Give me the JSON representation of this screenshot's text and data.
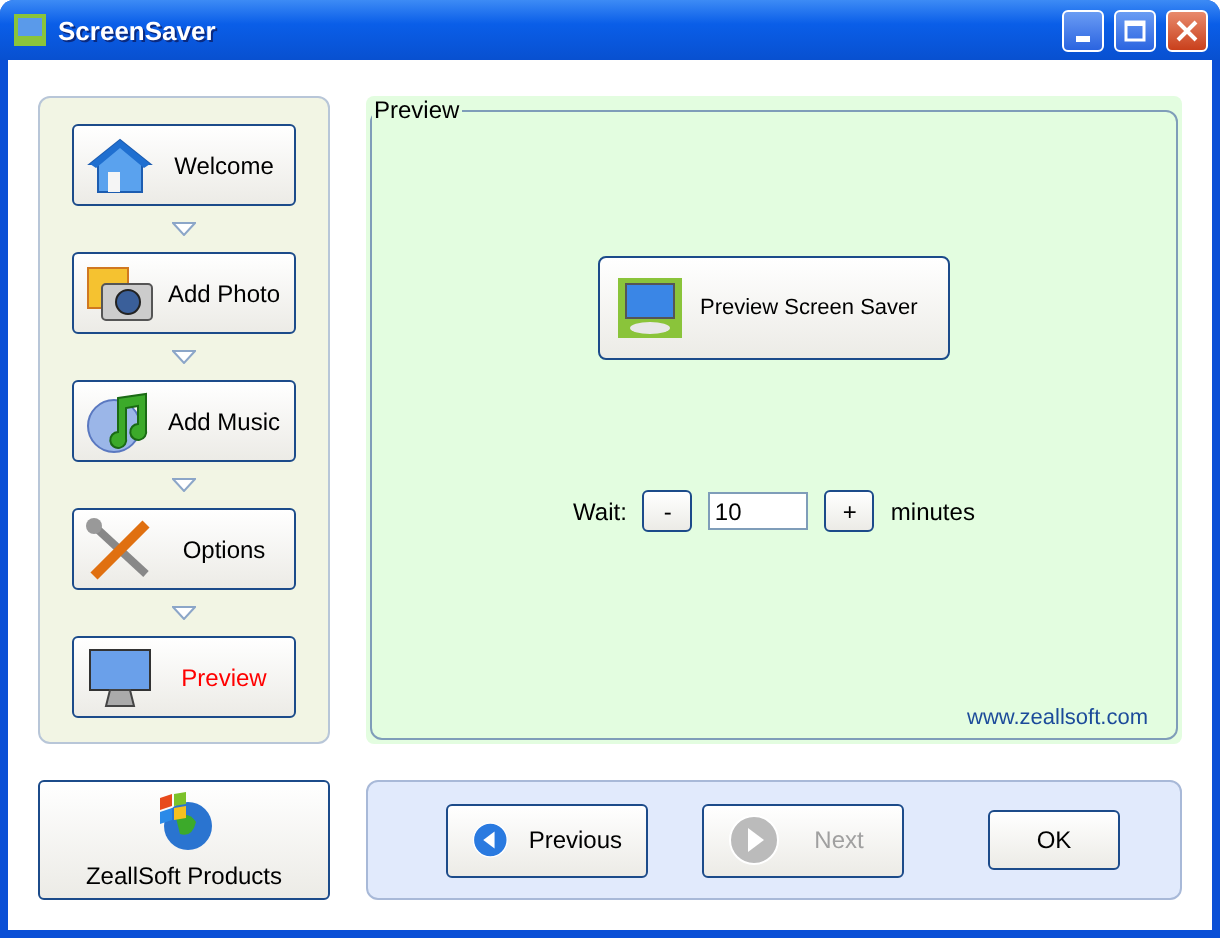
{
  "window": {
    "title": "ScreenSaver"
  },
  "steps": [
    {
      "label": "Welcome",
      "kind": "house",
      "selected": false
    },
    {
      "label": "Add Photo",
      "kind": "camera",
      "selected": false
    },
    {
      "label": "Add Music",
      "kind": "music",
      "selected": false
    },
    {
      "label": "Options",
      "kind": "tools",
      "selected": false
    },
    {
      "label": "Preview",
      "kind": "monitor",
      "selected": true
    }
  ],
  "preview": {
    "title": "Preview",
    "button": "Preview Screen Saver",
    "wait_label": "Wait:",
    "decrement": "-",
    "value": "10",
    "increment": "+",
    "unit": "minutes",
    "link": "www.zeallsoft.com"
  },
  "products_button": "ZeallSoft Products",
  "nav": [
    {
      "kind": "previous",
      "label": "Previous",
      "disabled": false
    },
    {
      "kind": "next",
      "label": "Next",
      "disabled": true
    },
    {
      "kind": "ok",
      "label": "OK",
      "disabled": false
    }
  ]
}
